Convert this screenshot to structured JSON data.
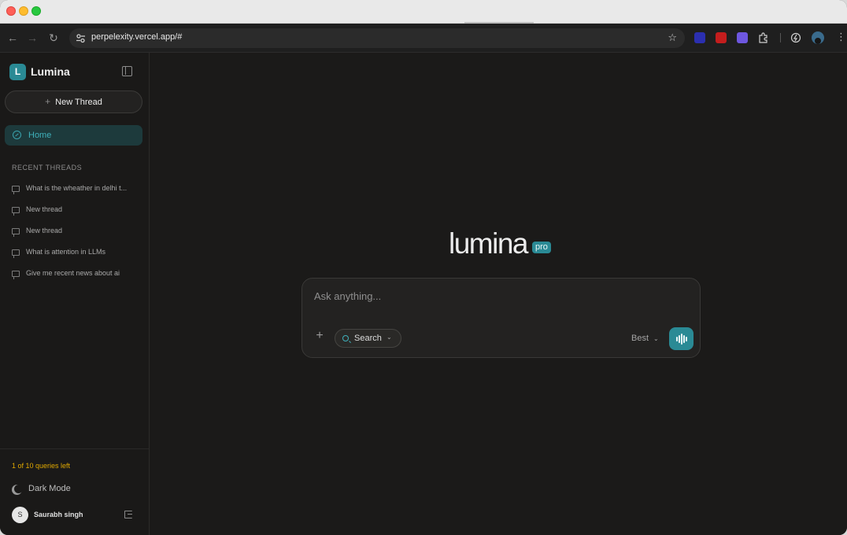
{
  "browser": {
    "url": "perpelexity.vercel.app/#"
  },
  "sidebar": {
    "brand_letter": "L",
    "brand_name": "Lumina",
    "new_thread_label": "New Thread",
    "home_label": "Home",
    "recent_heading": "RECENT THREADS",
    "threads": [
      {
        "label": "What is the wheather in delhi t..."
      },
      {
        "label": "New thread"
      },
      {
        "label": "New thread"
      },
      {
        "label": "What is attention in LLMs"
      },
      {
        "label": "Give me recent news about ai"
      }
    ],
    "queries_left": "1 of 10 queries left",
    "dark_mode_label": "Dark Mode",
    "user_initial": "S",
    "user_name": "Saurabh singh"
  },
  "main": {
    "hero_word": "lumina",
    "hero_badge": "pro",
    "input_placeholder": "Ask anything...",
    "search_label": "Search",
    "model_label": "Best"
  },
  "colors": {
    "accent": "#2a8a95",
    "queries_text": "#e0a800",
    "background": "#1b1a19"
  }
}
